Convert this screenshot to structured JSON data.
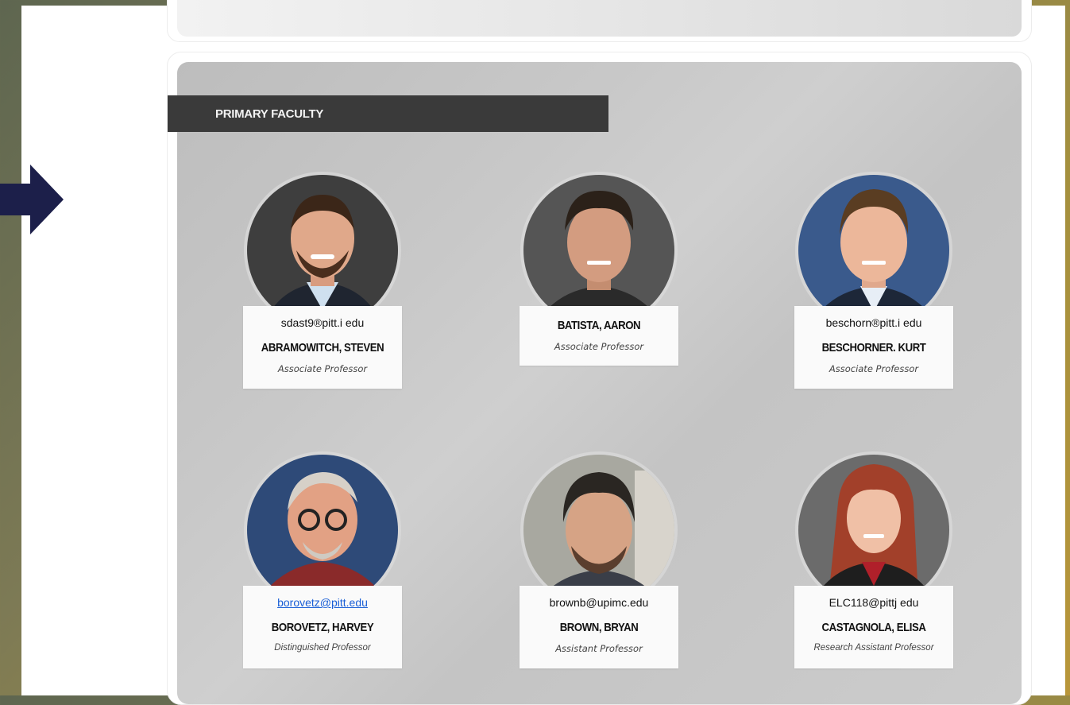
{
  "section": {
    "title": "PRIMARY FACULTY"
  },
  "colors": {
    "header_bg": "#3a3a3a",
    "arrow": "#1c1f4a",
    "link": "#1a5fd6"
  },
  "faculty": [
    {
      "email": "sdast9®pitt.i  edu",
      "name": "ABRAMOWITCH, STEVEN",
      "role": "Associate Professor",
      "email_link": false
    },
    {
      "email": "",
      "name": "BATISTA, AARON",
      "role": "Associate Professor",
      "email_link": false
    },
    {
      "email": "beschorn®pitt.i  edu",
      "name": "BESCHORNER. KURT",
      "role": "Associate Professor",
      "email_link": false
    },
    {
      "email": "borovetz@pitt.edu",
      "name": "BOROVETZ, HARVEY",
      "role": "Distinguished Professor",
      "email_link": true
    },
    {
      "email": "brownb@upimc.edu",
      "name": "BROWN, BRYAN",
      "role": "Assistant Professor",
      "email_link": false
    },
    {
      "email": "ELC118@pittj  edu",
      "name": "CASTAGNOLA, ELISA",
      "role": "Research Assistant Professor",
      "email_link": false
    }
  ]
}
